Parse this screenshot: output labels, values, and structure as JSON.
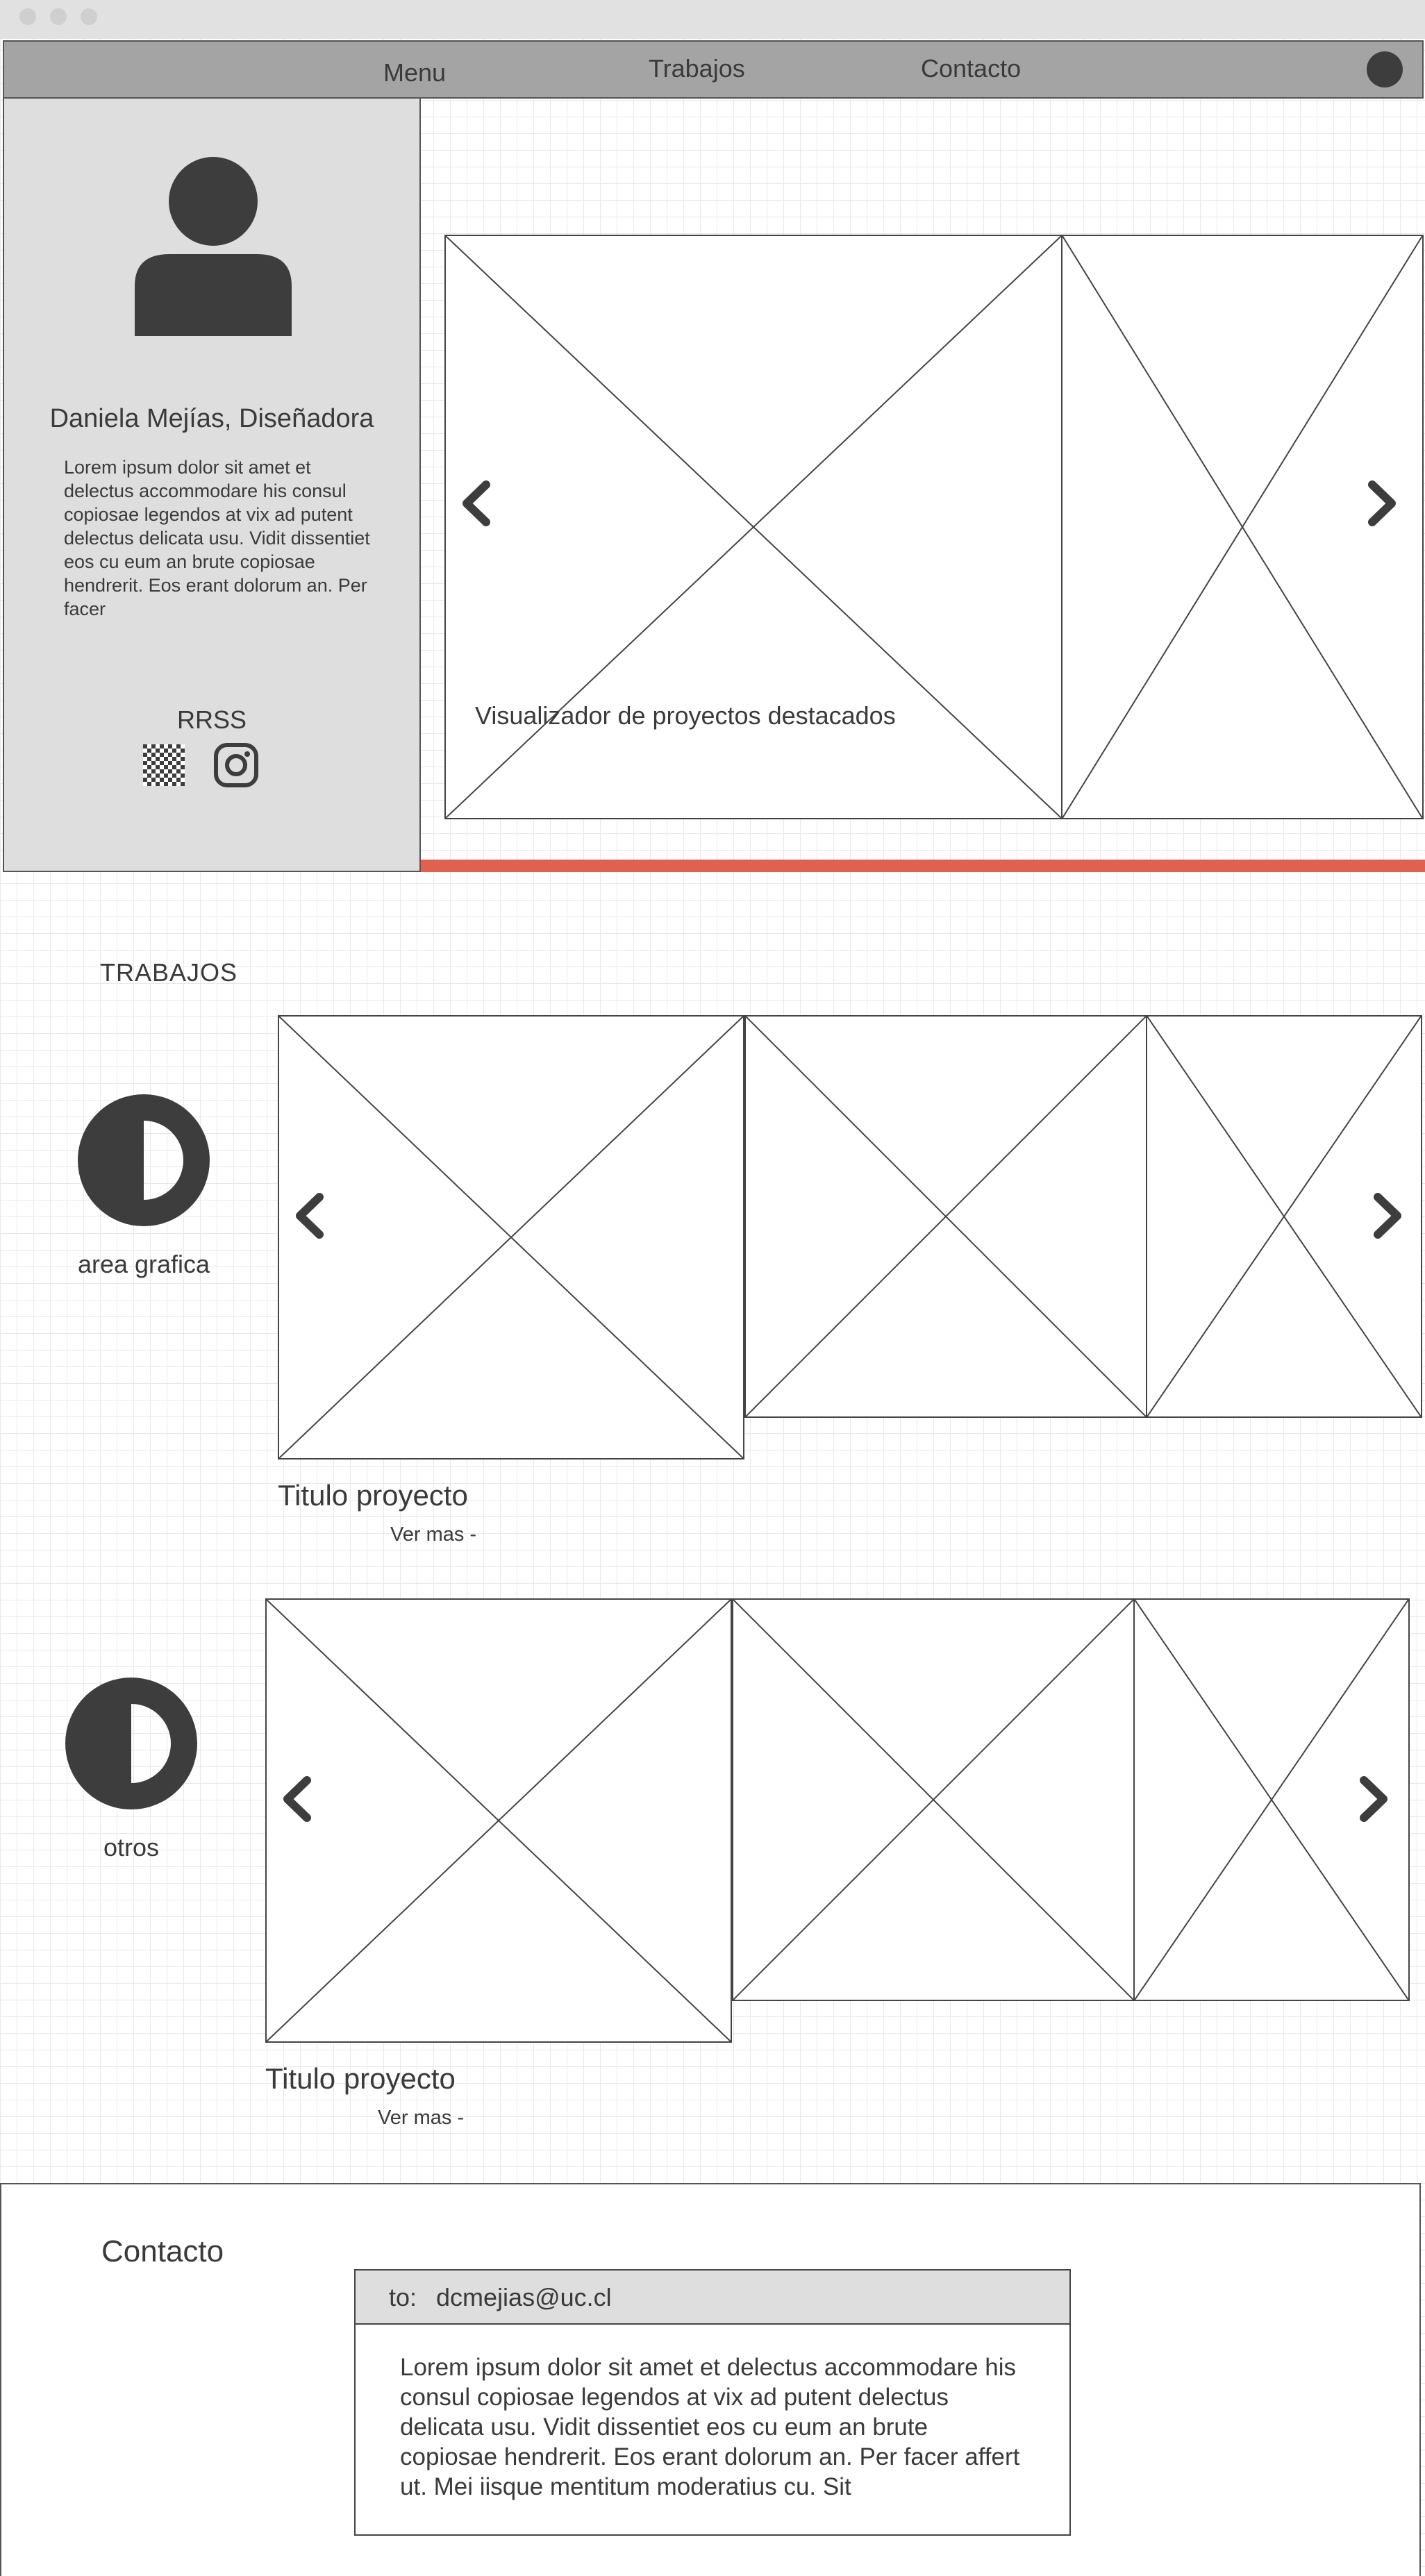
{
  "nav": {
    "menu": "Menu",
    "trabajos": "Trabajos",
    "contacto": "Contacto"
  },
  "profile": {
    "name": "Daniela Mejías, Diseñadora",
    "bio": "Lorem ipsum dolor sit amet et delectus accommodare his consul copiosae legendos at vix ad putent delectus delicata usu. Vidit dissentiet eos cu eum an brute copiosae hendrerit. Eos erant dolorum an. Per facer",
    "rrss_label": "RRSS"
  },
  "featured": {
    "caption": "Visualizador de proyectos destacados"
  },
  "trabajos": {
    "title": "TRABAJOS",
    "categories": [
      {
        "label": "area grafica",
        "project_title": "Titulo proyecto",
        "more": "Ver mas -"
      },
      {
        "label": "otros",
        "project_title": "Titulo proyecto",
        "more": "Ver mas -"
      }
    ]
  },
  "contact": {
    "title": "Contacto",
    "to_label": "to:",
    "email": "dcmejias@uc.cl",
    "message": "Lorem ipsum dolor sit amet et delectus accommodare his consul copiosae legendos at vix ad putent delectus delicata usu. Vidit dissentiet eos cu eum an brute copiosae hendrerit. Eos erant dolorum an. Per facer affert ut. Mei iisque mentitum moderatius cu. Sit"
  },
  "colors": {
    "accent": "#e0614f",
    "nav_bg": "#a4a4a4",
    "sidebar_bg": "#dedede",
    "icon": "#3d3d3d"
  }
}
